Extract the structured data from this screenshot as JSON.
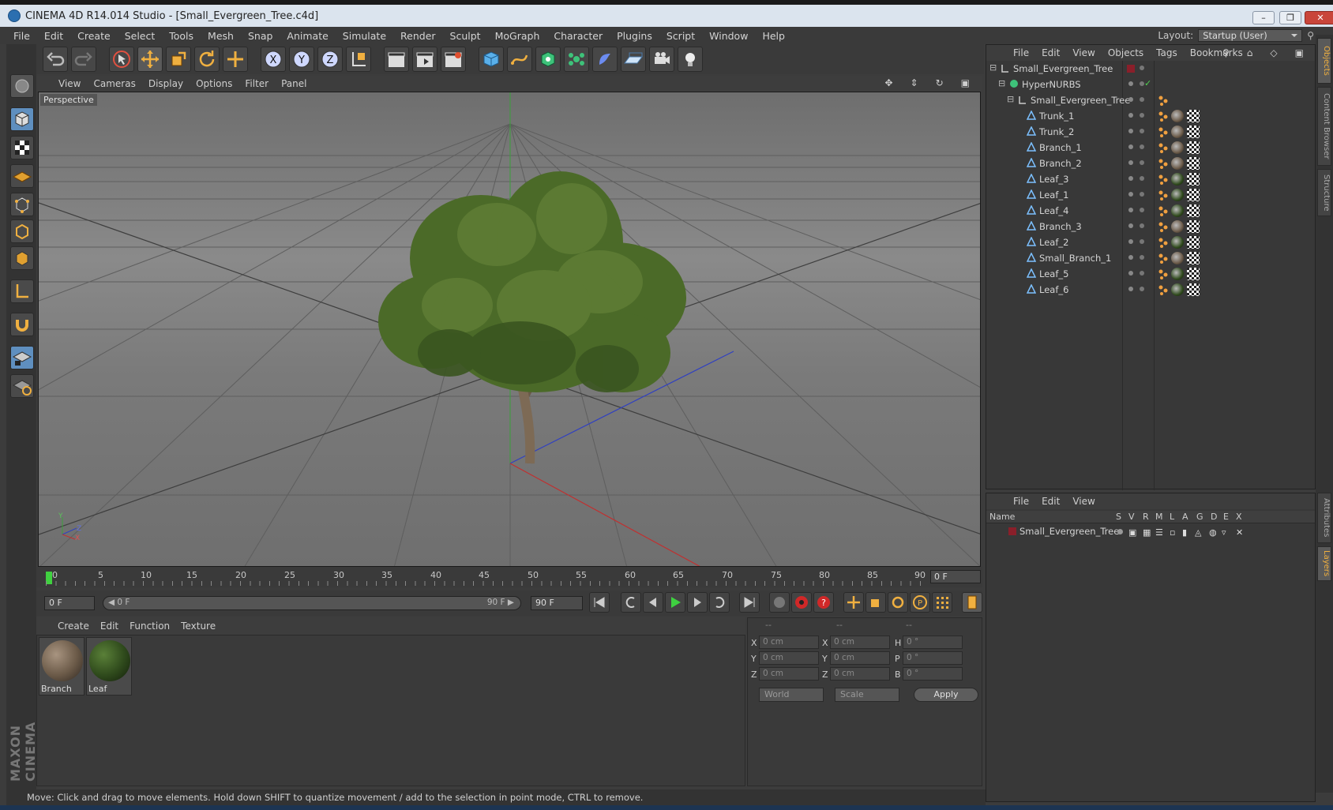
{
  "window": {
    "title": "CINEMA 4D R14.014 Studio - [Small_Evergreen_Tree.c4d]",
    "controls": {
      "minimize": "–",
      "restore": "❐",
      "close": "✕"
    }
  },
  "menubar": {
    "items": [
      "File",
      "Edit",
      "Create",
      "Select",
      "Tools",
      "Mesh",
      "Snap",
      "Animate",
      "Simulate",
      "Render",
      "Sculpt",
      "MoGraph",
      "Character",
      "Plugins",
      "Script",
      "Window",
      "Help"
    ],
    "layout_label": "Layout:",
    "layout_value": "Startup (User)"
  },
  "viewport": {
    "menu": [
      "View",
      "Cameras",
      "Display",
      "Options",
      "Filter",
      "Panel"
    ],
    "label": "Perspective",
    "axes": {
      "x": "X",
      "y": "Y",
      "z": "Z"
    }
  },
  "timeline": {
    "ticks": [
      "0",
      "5",
      "10",
      "15",
      "20",
      "25",
      "30",
      "35",
      "40",
      "45",
      "50",
      "55",
      "60",
      "65",
      "70",
      "75",
      "80",
      "85",
      "90"
    ],
    "current_frame": "0 F"
  },
  "transport": {
    "start": "0 F",
    "range_start": "◀ 0 F",
    "range_end": "90 F ▶",
    "end": "90 F"
  },
  "materials": {
    "menu": [
      "Create",
      "Edit",
      "Function",
      "Texture"
    ],
    "items": [
      {
        "name": "Branch",
        "color": "#6b5a48"
      },
      {
        "name": "Leaf",
        "color": "#2f4a1c"
      }
    ]
  },
  "coordinates": {
    "headers": [
      "--",
      "--",
      "--"
    ],
    "rows": [
      {
        "a": "X",
        "av": "0 cm",
        "b": "X",
        "bv": "0 cm",
        "c": "H",
        "cv": "0 °"
      },
      {
        "a": "Y",
        "av": "0 cm",
        "b": "Y",
        "bv": "0 cm",
        "c": "P",
        "cv": "0 °"
      },
      {
        "a": "Z",
        "av": "0 cm",
        "b": "Z",
        "bv": "0 cm",
        "c": "B",
        "cv": "0 °"
      }
    ],
    "mode1": "World",
    "mode2": "Scale",
    "apply": "Apply"
  },
  "objects": {
    "menu": [
      "File",
      "Edit",
      "View",
      "Objects",
      "Tags",
      "Bookmarks"
    ],
    "tree": [
      {
        "name": "Small_Evergreen_Tree",
        "level": 0,
        "icon": "null",
        "mat": ""
      },
      {
        "name": "HyperNURBS",
        "level": 1,
        "icon": "nurbs",
        "mat": ""
      },
      {
        "name": "Small_Evergreen_Tree",
        "level": 2,
        "icon": "null",
        "mat": ""
      },
      {
        "name": "Trunk_1",
        "level": 3,
        "icon": "poly",
        "mat": "branch"
      },
      {
        "name": "Trunk_2",
        "level": 3,
        "icon": "poly",
        "mat": "branch"
      },
      {
        "name": "Branch_1",
        "level": 3,
        "icon": "poly",
        "mat": "branch"
      },
      {
        "name": "Branch_2",
        "level": 3,
        "icon": "poly",
        "mat": "branch"
      },
      {
        "name": "Leaf_3",
        "level": 3,
        "icon": "poly",
        "mat": "leaf"
      },
      {
        "name": "Leaf_1",
        "level": 3,
        "icon": "poly",
        "mat": "leaf"
      },
      {
        "name": "Leaf_4",
        "level": 3,
        "icon": "poly",
        "mat": "leaf"
      },
      {
        "name": "Branch_3",
        "level": 3,
        "icon": "poly",
        "mat": "branch"
      },
      {
        "name": "Leaf_2",
        "level": 3,
        "icon": "poly",
        "mat": "leaf"
      },
      {
        "name": "Small_Branch_1",
        "level": 3,
        "icon": "poly",
        "mat": "branch"
      },
      {
        "name": "Leaf_5",
        "level": 3,
        "icon": "poly",
        "mat": "leaf"
      },
      {
        "name": "Leaf_6",
        "level": 3,
        "icon": "poly",
        "mat": "leaf"
      }
    ]
  },
  "layers": {
    "menu": [
      "File",
      "Edit",
      "View"
    ],
    "columns": [
      "Name",
      "S",
      "V",
      "R",
      "M",
      "L",
      "A",
      "G",
      "D",
      "E",
      "X"
    ],
    "row_name": "Small_Evergreen_Tree",
    "row_color": "#8a1f2a"
  },
  "sidetabs": [
    "Objects",
    "Content Browser",
    "Structure",
    "Attributes",
    "Layers"
  ],
  "status": "Move: Click and drag to move elements. Hold down SHIFT to quantize movement / add to the selection in point mode, CTRL to remove.",
  "brand": "MAXON CINEMA 4D",
  "colors": {
    "accent": "#5f8fbf",
    "selected_tab": "#f0b040"
  }
}
